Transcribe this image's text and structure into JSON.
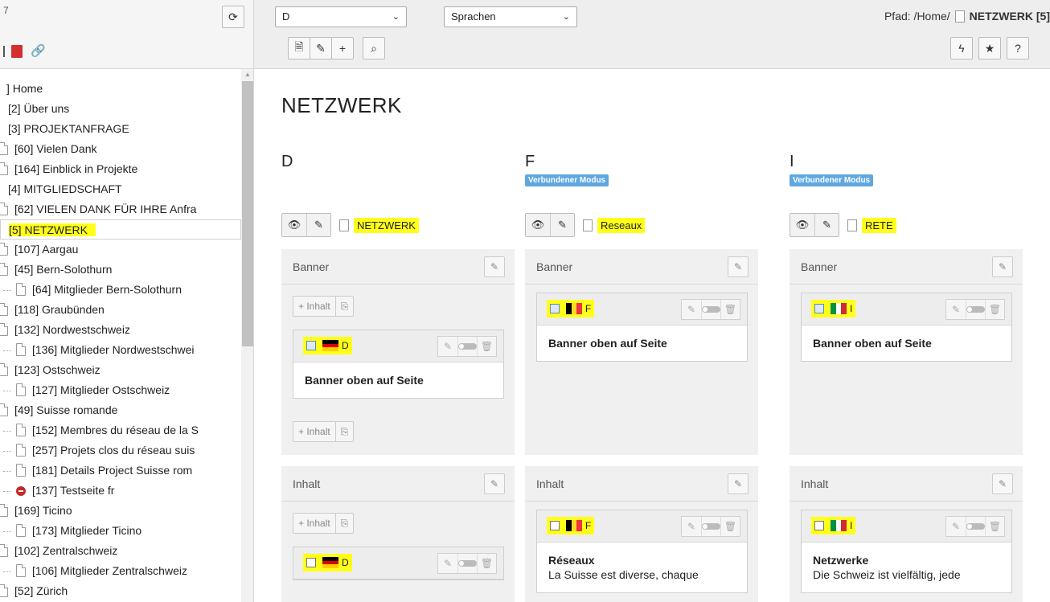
{
  "tree_toolbar": {
    "partial_left": "7"
  },
  "tree": {
    "items": [
      {
        "label": "] Home",
        "indent": 0,
        "icon": "none"
      },
      {
        "label": "[2] Über uns",
        "indent": 1,
        "icon": "none"
      },
      {
        "label": "[3] PROJEKTANFRAGE",
        "indent": 1,
        "icon": "none"
      },
      {
        "label": "[60] Vielen Dank",
        "indent": 1,
        "icon": "page"
      },
      {
        "label": "[164] Einblick in Projekte",
        "indent": 1,
        "icon": "page"
      },
      {
        "label": "[4] MITGLIEDSCHAFT",
        "indent": 1,
        "icon": "none"
      },
      {
        "label": "[62] VIELEN DANK FÜR IHRE Anfra",
        "indent": 1,
        "icon": "page"
      },
      {
        "label": "[5] NETZWERK",
        "indent": 1,
        "icon": "none",
        "selected": true
      },
      {
        "label": "[107] Aargau",
        "indent": 1,
        "icon": "page"
      },
      {
        "label": "[45] Bern-Solothurn",
        "indent": 1,
        "icon": "page"
      },
      {
        "label": "[64] Mitglieder Bern-Solothurn",
        "indent": 2,
        "icon": "page"
      },
      {
        "label": "[118] Graubünden",
        "indent": 1,
        "icon": "page"
      },
      {
        "label": "[132] Nordwestschweiz",
        "indent": 1,
        "icon": "page"
      },
      {
        "label": "[136] Mitglieder Nordwestschwei",
        "indent": 2,
        "icon": "page"
      },
      {
        "label": "[123] Ostschweiz",
        "indent": 1,
        "icon": "page"
      },
      {
        "label": "[127] Mitglieder Ostschweiz",
        "indent": 2,
        "icon": "page"
      },
      {
        "label": "[49] Suisse romande",
        "indent": 1,
        "icon": "page"
      },
      {
        "label": "[152] Membres du réseau de la S",
        "indent": 2,
        "icon": "page"
      },
      {
        "label": "[257] Projets clos du réseau suis",
        "indent": 2,
        "icon": "page"
      },
      {
        "label": "[181] Details Project Suisse rom",
        "indent": 2,
        "icon": "page"
      },
      {
        "label": "[137] Testseite fr",
        "indent": 2,
        "icon": "stop"
      },
      {
        "label": "[169] Ticino",
        "indent": 1,
        "icon": "page"
      },
      {
        "label": "[173] Mitglieder Ticino",
        "indent": 2,
        "icon": "page"
      },
      {
        "label": "[102] Zentralschweiz",
        "indent": 1,
        "icon": "page"
      },
      {
        "label": "[106] Mitglieder Zentralschweiz",
        "indent": 2,
        "icon": "page"
      },
      {
        "label": "[52] Zürich",
        "indent": 1,
        "icon": "page"
      }
    ]
  },
  "topbar": {
    "language_select": "D",
    "view_select": "Sprachen",
    "path_prefix": "Pfad: /Home/",
    "path_page": "NETZWERK [5]"
  },
  "main": {
    "title": "NETZWERK",
    "columns": [
      {
        "lang": "D",
        "badge": "",
        "page_title": "NETZWERK",
        "flag": "de",
        "flag_label": "D",
        "banner_label": "Banner",
        "add_label": "Inhalt",
        "banner_card_title": "Banner oben auf Seite",
        "content_label": "Inhalt",
        "content_card_title": "",
        "content_card_text": ""
      },
      {
        "lang": "F",
        "badge": "Verbundener Modus",
        "page_title": "Reseaux",
        "flag": "be",
        "flag_label": "F",
        "banner_label": "Banner",
        "banner_card_title": "Banner oben auf Seite",
        "content_label": "Inhalt",
        "content_card_title": "Réseaux",
        "content_card_text": "La Suisse est diverse, chaque"
      },
      {
        "lang": "I",
        "badge": "Verbundener Modus",
        "page_title": "RETE",
        "flag": "it",
        "flag_label": "I",
        "banner_label": "Banner",
        "banner_card_title": "Banner oben auf Seite",
        "content_label": "Inhalt",
        "content_card_title": "Netzwerke",
        "content_card_text": "Die Schweiz ist vielfältig, jede"
      }
    ]
  },
  "colors": {
    "highlight": "#ffff1a",
    "badge": "#5fa7e0",
    "de_flag": [
      "#000000",
      "#dd0000",
      "#ffce00"
    ],
    "be_flag": [
      "#000000",
      "#fdda24",
      "#ef3340"
    ],
    "it_flag": [
      "#009246",
      "#ffffff",
      "#ce2b37"
    ]
  }
}
